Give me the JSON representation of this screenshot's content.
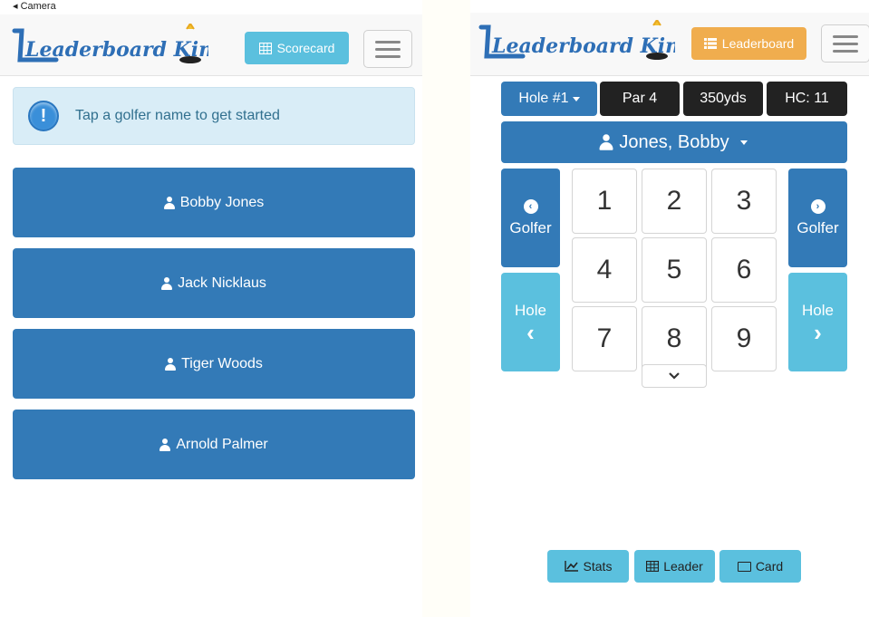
{
  "left": {
    "status": "◂ Camera",
    "logo_text": "Leaderboard King",
    "scorecard_label": "Scorecard",
    "alert_text": "Tap a golfer name to get started",
    "golfers": [
      "Bobby Jones",
      "Jack Nicklaus",
      "Tiger Woods",
      "Arnold Palmer"
    ]
  },
  "right": {
    "logo_text": "Leaderboard King",
    "leaderboard_label": "Leaderboard",
    "hole_label": "Hole #1",
    "par_label": "Par 4",
    "yards_label": "350yds",
    "hc_label": "HC: 11",
    "current_golfer": "Jones, Bobby",
    "prev_golfer_label": "Golfer",
    "next_golfer_label": "Golfer",
    "prev_hole_label": "Hole",
    "next_hole_label": "Hole",
    "keys": [
      "1",
      "2",
      "3",
      "4",
      "5",
      "6",
      "7",
      "8",
      "9"
    ],
    "stats_label": "Stats",
    "leader_label": "Leader",
    "card_label": "Card"
  },
  "colors": {
    "primary": "#337ab7",
    "info": "#5bc0de",
    "warning": "#f0ad4e",
    "dark": "#222222",
    "alert_bg": "#d9edf7"
  },
  "icons": [
    "user-icon",
    "info-icon",
    "table-icon",
    "list-icon",
    "chevron-left-icon",
    "chevron-right-icon",
    "chart-icon",
    "card-icon",
    "hamburger-icon"
  ]
}
